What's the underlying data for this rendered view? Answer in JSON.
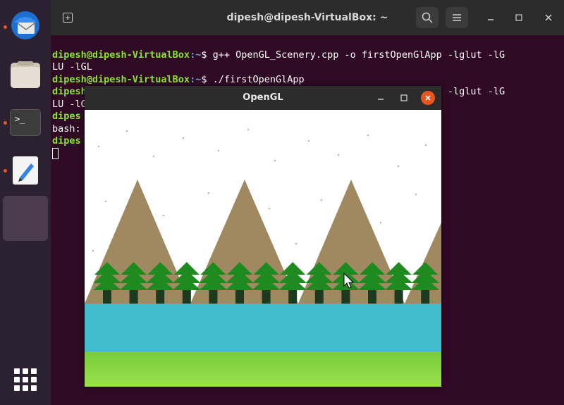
{
  "dock": {
    "items": [
      {
        "name": "thunderbird",
        "icon": "mail-icon"
      },
      {
        "name": "files",
        "icon": "folder-icon"
      },
      {
        "name": "terminal",
        "icon": "terminal-icon",
        "label": ">_"
      },
      {
        "name": "text-editor",
        "icon": "pencil-icon"
      },
      {
        "name": "running-app",
        "icon": "window-icon"
      }
    ]
  },
  "terminal": {
    "title": "dipesh@dipesh-VirtualBox: ~",
    "new_tab_icon": "new-tab-icon",
    "lines": [
      {
        "user": "dipesh@dipesh-VirtualBox",
        "path": ":~",
        "cmd": "$ g++ OpenGL_Scenery.cpp -o firstOpenGlApp -lglut -lG"
      },
      {
        "text": "LU -lGL"
      },
      {
        "user": "dipesh@dipesh-VirtualBox",
        "path": ":~",
        "cmd": "$ ./firstOpenGlApp"
      },
      {
        "user": "dipesh@dipesh-VirtualBox",
        "path": ":~",
        "cmd": "$ g++ OpenGL_Scenery.cpp -o firstOpenGlApp -lglut -lG"
      },
      {
        "text": "LU -lG"
      },
      {
        "user": "dipes",
        "path": "",
        "cmd": ""
      },
      {
        "text": "bash:"
      },
      {
        "user": "dipes",
        "path": "",
        "cmd": ""
      }
    ]
  },
  "gl_window": {
    "title": "OpenGL"
  },
  "colors": {
    "terminal_bg": "#300a24",
    "prompt_user": "#8ae234",
    "prompt_path": "#729fcf",
    "sky": "#ffffff",
    "mountain": "#a08860",
    "tree": "#1f8a1f",
    "trunk": "#1e3a1e",
    "water": "#3fbccd",
    "grass": "#7ccf3c",
    "close_button": "#e95420"
  }
}
